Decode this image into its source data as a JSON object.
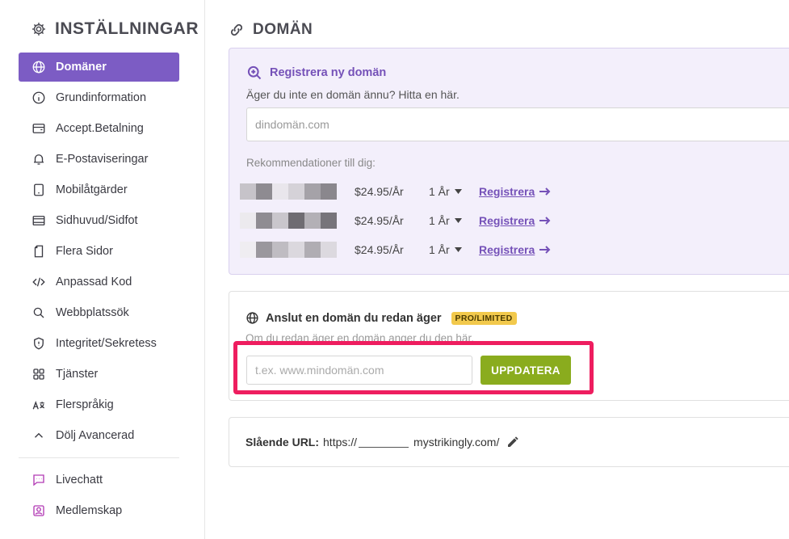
{
  "sidebar": {
    "title": "INSTÄLLNINGAR",
    "items": [
      {
        "label": "Domäner",
        "icon": "globe-icon",
        "active": true
      },
      {
        "label": "Grundinformation",
        "icon": "info-icon"
      },
      {
        "label": "Accept.Betalning",
        "icon": "wallet-icon"
      },
      {
        "label": "E-Postaviseringar",
        "icon": "bell-icon"
      },
      {
        "label": "Mobilåtgärder",
        "icon": "mobile-icon"
      },
      {
        "label": "Sidhuvud/Sidfot",
        "icon": "layout-icon"
      },
      {
        "label": "Flera Sidor",
        "icon": "pages-icon"
      },
      {
        "label": "Anpassad Kod",
        "icon": "code-icon"
      },
      {
        "label": "Webbplatssök",
        "icon": "search-icon"
      },
      {
        "label": "Integritet/Sekretess",
        "icon": "shield-icon"
      },
      {
        "label": "Tjänster",
        "icon": "grid-icon"
      },
      {
        "label": "Flerspråkig",
        "icon": "translate-icon"
      },
      {
        "label": "Dölj Avancerad",
        "icon": "chevron-up-icon"
      }
    ],
    "extra_items": [
      {
        "label": "Livechatt",
        "icon": "chat-icon"
      },
      {
        "label": "Medlemskap",
        "icon": "member-icon"
      }
    ]
  },
  "main": {
    "title": "DOMÄN",
    "register": {
      "heading": "Registrera ny domän",
      "subtitle": "Äger du inte en domän ännu? Hitta en här.",
      "placeholder": "dindomän.com",
      "rec_label": "Rekommendationer till dig:",
      "recommendations": [
        {
          "price": "$24.95/År",
          "years": "1 År",
          "link": "Registrera"
        },
        {
          "price": "$24.95/År",
          "years": "1 År",
          "link": "Registrera"
        },
        {
          "price": "$24.95/År",
          "years": "1 År",
          "link": "Registrera"
        }
      ]
    },
    "connect": {
      "heading": "Anslut en domän du redan äger",
      "badge": "PRO/LIMITED",
      "subtitle": "Om du redan äger en domän anger du den här.",
      "placeholder": "t.ex. www.mindomän.com",
      "button": "UPPDATERA"
    },
    "url": {
      "label": "Slående URL:",
      "prefix": "https://",
      "suffix": "mystrikingly.com/"
    }
  },
  "colors": {
    "accent": "#7c5cc4",
    "button_green": "#8aac1e",
    "highlight": "#ee1d5f",
    "badge": "#f2c94c"
  }
}
